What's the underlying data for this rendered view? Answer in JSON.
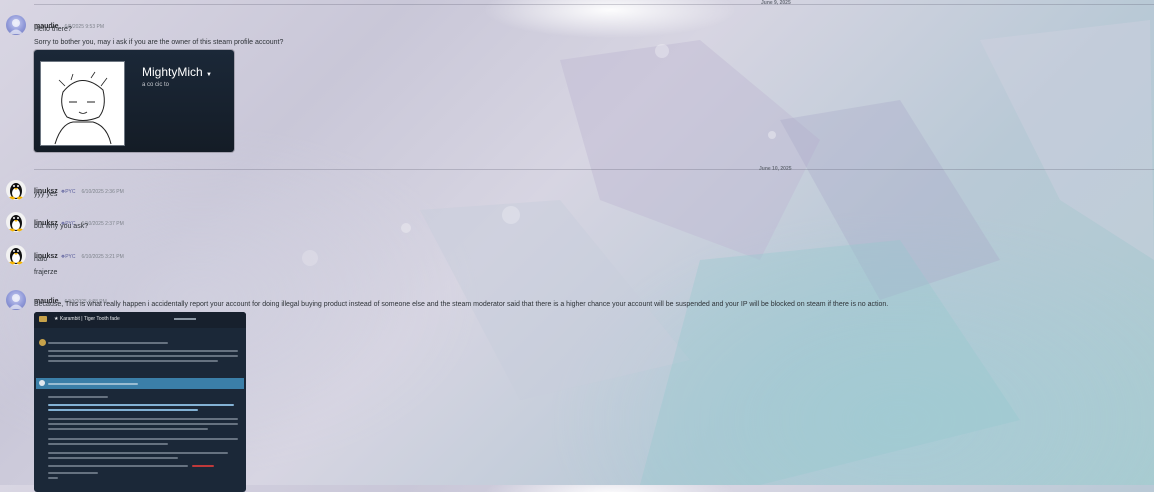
{
  "dates": {
    "first": "June 9, 2025",
    "second": "June 10, 2025"
  },
  "messages": [
    {
      "user": "maudie",
      "timestamp": "6/9/2025 9:53 PM",
      "lines": [
        "Hello there?",
        "Sorry to bother you, may i ask if you are the owner of this steam profile account?"
      ]
    },
    {
      "user": "linuksz",
      "tag": "PYC",
      "timestamp": "6/10/2025 2:36 PM",
      "lines": [
        "yyy yes"
      ]
    },
    {
      "user": "linuksz",
      "tag": "PYC",
      "timestamp": "6/10/2025 2:37 PM",
      "lines": [
        "but why you ask?"
      ]
    },
    {
      "user": "linuksz",
      "tag": "PYC",
      "timestamp": "6/10/2025 3:21 PM",
      "lines": [
        "halo",
        "frajerze"
      ]
    },
    {
      "user": "maudie",
      "timestamp": "6/10/2025 4:28 PM",
      "lines": [
        "Because, This is what really happen i accidentally report your account for doing illegal buying product instead of someone else and the steam moderator said that there is a higher chance your account will be suspended and your IP will be blocked on steam if there is no action."
      ]
    }
  ],
  "profile_embed": {
    "name": "MightyMich",
    "subtitle": "a co cic to"
  },
  "steam_embed": {
    "title": "★ Karambit | Tiger Tooth fade"
  },
  "icons": {
    "tag_icon": "clan-tag-icon",
    "dropdown": "chevron-down-icon"
  }
}
